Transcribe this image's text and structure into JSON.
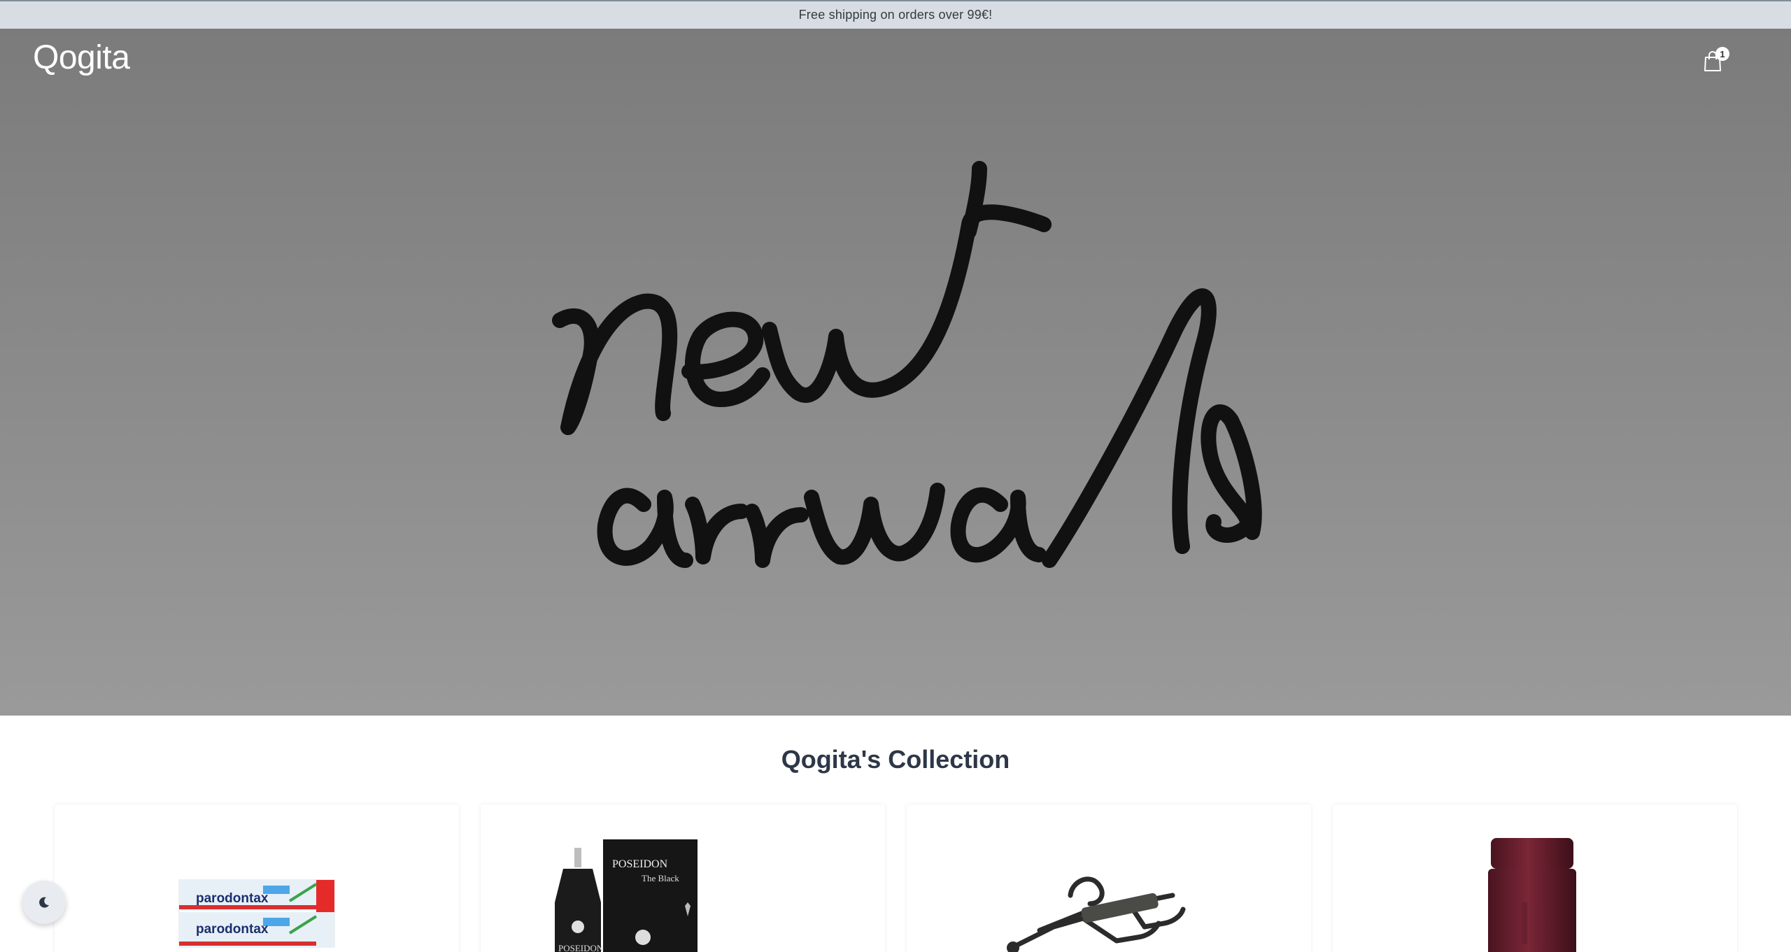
{
  "announcement": {
    "text": "Free shipping on orders over 99€!"
  },
  "header": {
    "logo": "Qogita",
    "cart_count": "1"
  },
  "hero": {
    "headline_line1": "new",
    "headline_line2": "arrivals"
  },
  "collection": {
    "title": "Qogita's Collection"
  },
  "products": [
    {
      "brand": "parodontax",
      "icon": "toothpaste-product-image"
    },
    {
      "brand": "POSEIDON",
      "subtitle": "The Black",
      "bottle_text": "POSEIDON",
      "icon": "perfume-product-image"
    },
    {
      "icon": "snow-sled-product-image"
    },
    {
      "icon": "cologne-bottle-product-image"
    }
  ],
  "colors": {
    "announce_bg": "#d7dde3",
    "hero_top": "#7b7b7b",
    "hero_bottom": "#9a9a9a",
    "title_text": "#2d3748"
  },
  "theme_toggle": {
    "icon": "moon-icon"
  }
}
